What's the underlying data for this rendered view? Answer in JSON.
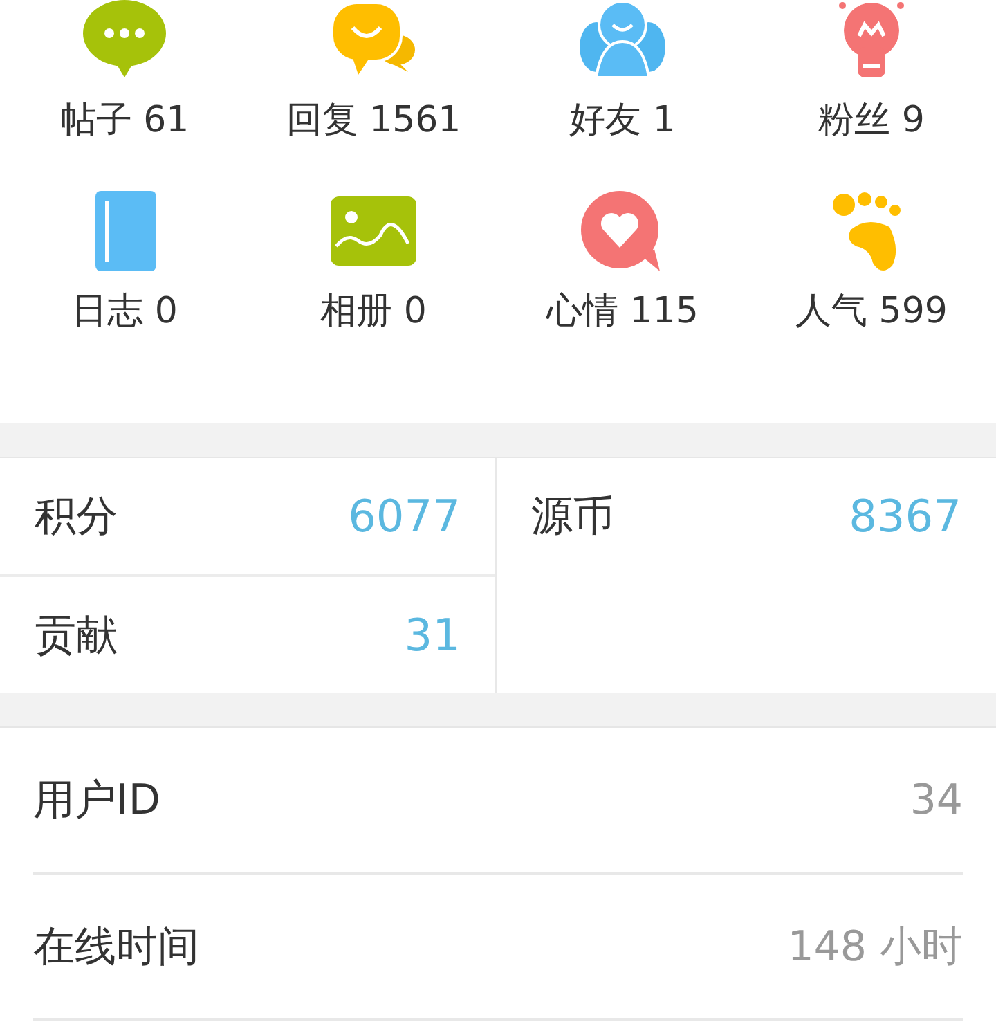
{
  "shortcuts": [
    {
      "kind": "chat",
      "label": "帖子 61"
    },
    {
      "kind": "reply",
      "label": "回复 1561"
    },
    {
      "kind": "friends",
      "label": "好友 1"
    },
    {
      "kind": "bulb",
      "label": "粉丝 9"
    },
    {
      "kind": "notebook",
      "label": "日志 0"
    },
    {
      "kind": "album",
      "label": "相册 0"
    },
    {
      "kind": "mood",
      "label": "心情 115"
    },
    {
      "kind": "footprint",
      "label": "人气 599"
    }
  ],
  "stats": {
    "left": [
      {
        "label": "积分",
        "value": "6077"
      },
      {
        "label": "贡献",
        "value": "31"
      }
    ],
    "right": [
      {
        "label": "源币",
        "value": "8367"
      }
    ]
  },
  "details": [
    {
      "label": "用户ID",
      "value": "34"
    },
    {
      "label": "在线时间",
      "value": "148 小时"
    }
  ]
}
